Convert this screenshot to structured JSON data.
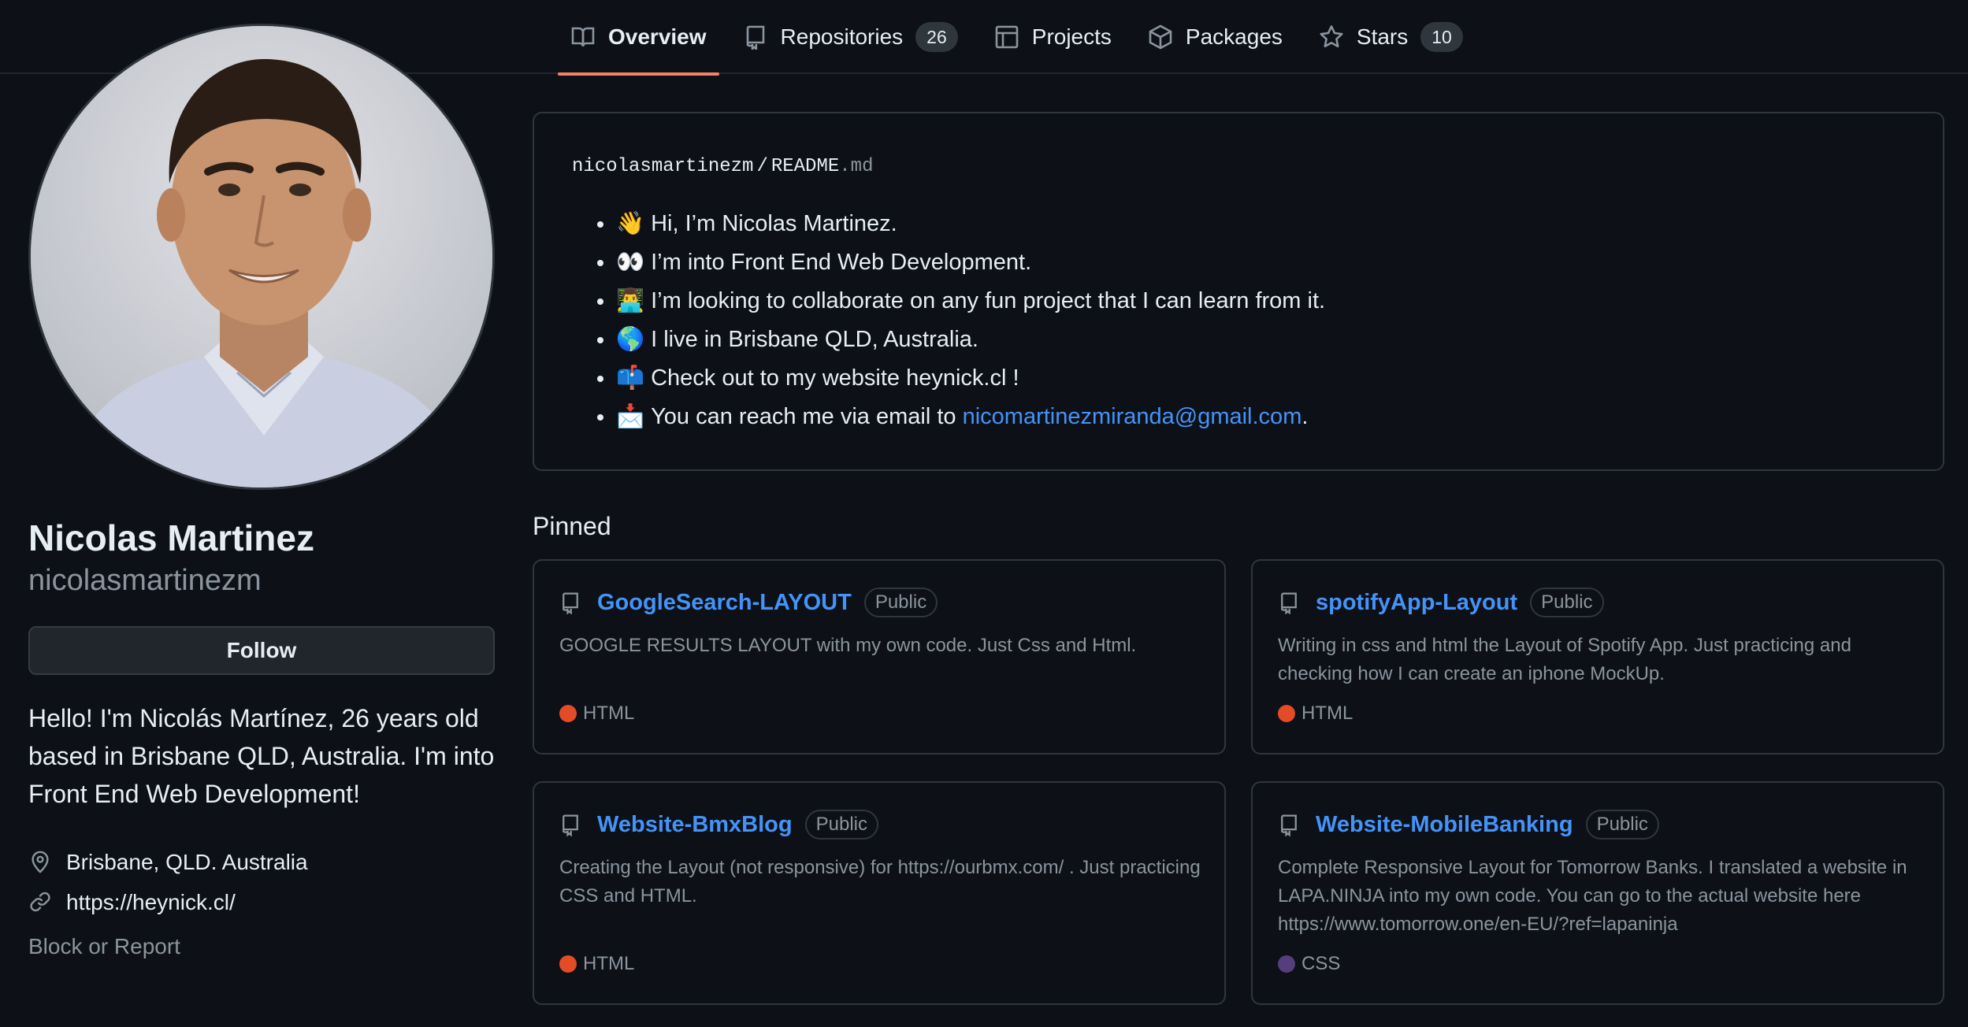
{
  "colors": {
    "background": "#0d1117",
    "border": "#30363d",
    "link": "#4493f8",
    "active_tab_underline": "#f78166",
    "muted_text": "#8b949e"
  },
  "nav": {
    "tabs": [
      {
        "label": "Overview",
        "icon": "book-icon",
        "active": true
      },
      {
        "label": "Repositories",
        "icon": "repo-icon",
        "count": "26"
      },
      {
        "label": "Projects",
        "icon": "table-icon"
      },
      {
        "label": "Packages",
        "icon": "package-icon"
      },
      {
        "label": "Stars",
        "icon": "star-icon",
        "count": "10"
      }
    ]
  },
  "profile": {
    "name": "Nicolas Martinez",
    "username": "nicolasmartinezm",
    "follow_label": "Follow",
    "bio": "Hello! I'm Nicolás Martínez, 26 years old based in Brisbane QLD, Australia. I'm into Front End Web Development!",
    "location": "Brisbane, QLD. Australia",
    "website": "https://heynick.cl/",
    "block_report": "Block or Report"
  },
  "readme": {
    "owner": "nicolasmartinezm",
    "separator": "/",
    "file_name": "README",
    "file_ext": ".md",
    "items": [
      {
        "emoji": "👋",
        "text": "Hi, I’m Nicolas Martinez."
      },
      {
        "emoji": "👀",
        "text": "I’m into Front End Web Development."
      },
      {
        "emoji": "👨‍💻",
        "text": "I’m looking to collaborate on any fun project that I can learn from it."
      },
      {
        "emoji": "🌎",
        "text": "I live in Brisbane QLD, Australia."
      },
      {
        "emoji": "📫",
        "text": "Check out to my website heynick.cl !"
      },
      {
        "emoji": "📩",
        "text": "You can reach me via email to ",
        "link": "nicomartinezmiranda@gmail.com",
        "suffix": "."
      }
    ]
  },
  "pinned": {
    "title": "Pinned",
    "repos": [
      {
        "name": "GoogleSearch-LAYOUT",
        "visibility": "Public",
        "description": "GOOGLE RESULTS LAYOUT with my own code. Just Css and Html.",
        "language": "HTML",
        "language_color": "#e34c26"
      },
      {
        "name": "spotifyApp-Layout",
        "visibility": "Public",
        "description": "Writing in css and html the Layout of Spotify App. Just practicing and checking how I can create an iphone MockUp.",
        "language": "HTML",
        "language_color": "#e34c26"
      },
      {
        "name": "Website-BmxBlog",
        "visibility": "Public",
        "description": "Creating the Layout (not responsive) for https://ourbmx.com/ . Just practicing CSS and HTML.",
        "language": "HTML",
        "language_color": "#e34c26"
      },
      {
        "name": "Website-MobileBanking",
        "visibility": "Public",
        "description": "Complete Responsive Layout for Tomorrow Banks. I translated a website in LAPA.NINJA into my own code. You can go to the actual website here https://www.tomorrow.one/en-EU/?ref=lapaninja",
        "language": "CSS",
        "language_color": "#563d7c"
      }
    ]
  }
}
